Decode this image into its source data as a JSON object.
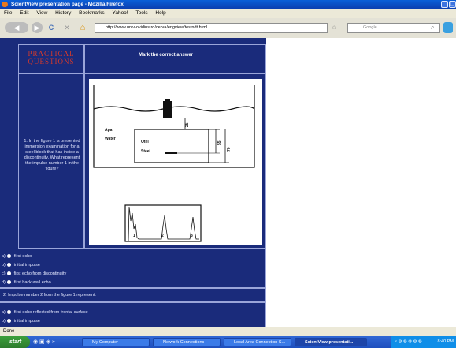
{
  "window": {
    "title": "ScientView presentation page - Mozilla Firefox",
    "minimize": "_",
    "maximize": "□"
  },
  "menu": [
    "File",
    "Edit",
    "View",
    "History",
    "Bookmarks",
    "Yahoo!",
    "Tools",
    "Help"
  ],
  "nav": {
    "back": "◀",
    "forward": "▶",
    "reload": "C",
    "stop": "✕",
    "home": "⌂",
    "url": "http://www.univ-ovidius.ro/cerva/engview/testndt.html",
    "search_placeholder": "Google",
    "search_icon": "magnifier-icon"
  },
  "page": {
    "section_title": "PRACTICAL QUESTIONS",
    "instruction": "Mark the correct answer",
    "question1": "1. In the figure 1 is presented immersion examination for a steel block that has inside a discontinuity. What represent the impulse number 1 in the figure?",
    "figure": {
      "apa": "Apa",
      "water": "Water",
      "otel": "Otel",
      "steel": "Steel",
      "dim1": "25",
      "dim2": "55",
      "dim3": "70",
      "peak1": "1",
      "peak2": "2",
      "peak3": "3"
    },
    "q1_options": [
      {
        "letter": "a)",
        "text": "first echo"
      },
      {
        "letter": "b)",
        "text": "initial impulse"
      },
      {
        "letter": "c)",
        "text": "first echo from discontinuity"
      },
      {
        "letter": "d)",
        "text": "first back-wall echo"
      }
    ],
    "question2": "2. Impulse number 2 from the figure 1 represent:",
    "q2_options": [
      {
        "letter": "a)",
        "text": "first echo reflected from frontal surface"
      },
      {
        "letter": "b)",
        "text": "initial impulse"
      }
    ]
  },
  "status": "Done",
  "taskbar": {
    "start": "start",
    "tasks": [
      "My Computer",
      "Network Connections",
      "Local Area Connection S...",
      "ScientView presentati..."
    ],
    "chevron": "»",
    "clock": "8:40 PM"
  }
}
